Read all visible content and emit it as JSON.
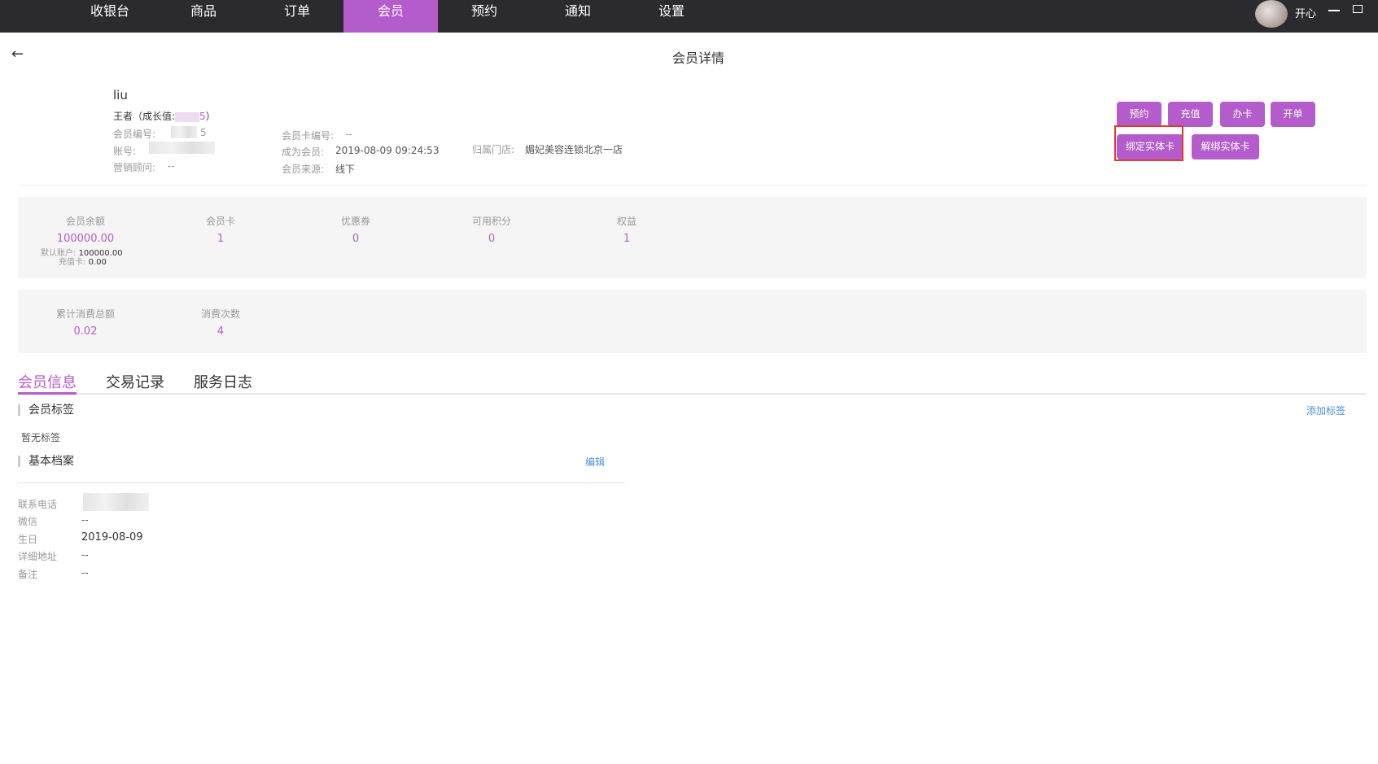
{
  "nav": {
    "items": [
      "收银台",
      "商品",
      "订单",
      "会员",
      "预约",
      "通知",
      "设置"
    ],
    "active": "会员",
    "user": "开心"
  },
  "page": {
    "title": "会员详情"
  },
  "member": {
    "name": "liu",
    "level_prefix": "王者（成长值:",
    "level_value_suffix": "5",
    "level_close": "）",
    "id_label": "会员编号:",
    "id_suffix": "5",
    "account_label": "账号:",
    "advisor_label": "营销顾问:",
    "advisor": "--",
    "card_no_label": "会员卡编号:",
    "card_no": "--",
    "joined_label": "成为会员:",
    "joined": "2019-08-09 09:24:53",
    "source_label": "会员来源:",
    "source": "线下",
    "store_label": "归属门店:",
    "store": "媚妃美容连锁北京一店"
  },
  "actions": [
    "预约",
    "充值",
    "办卡",
    "开单",
    "绑定实体卡",
    "解绑实体卡"
  ],
  "stats": [
    {
      "label": "会员余额",
      "value": "100000.00"
    },
    {
      "label": "会员卡",
      "value": "1"
    },
    {
      "label": "优惠券",
      "value": "0"
    },
    {
      "label": "可用积分",
      "value": "0"
    },
    {
      "label": "权益",
      "value": "1"
    }
  ],
  "balance_detail": {
    "default_label": "默认账户:",
    "default": "100000.00",
    "recharge_label": "充值卡:",
    "recharge": "0.00"
  },
  "stats2": [
    {
      "label": "累计消费总额",
      "value": "0.02"
    },
    {
      "label": "消费次数",
      "value": "4"
    }
  ],
  "tabs": [
    "会员信息",
    "交易记录",
    "服务日志"
  ],
  "tags": {
    "title": "会员标签",
    "add": "添加标签",
    "empty": "暂无标签"
  },
  "profile": {
    "title": "基本档案",
    "edit": "编辑",
    "fields": [
      {
        "label": "联系电话",
        "value": ""
      },
      {
        "label": "微信",
        "value": "--"
      },
      {
        "label": "生日",
        "value": "2019-08-09"
      },
      {
        "label": "详细地址",
        "value": "--"
      },
      {
        "label": "备注",
        "value": "--"
      }
    ]
  },
  "colors": {
    "accent": "#b45ccc",
    "link": "#4a90e2",
    "highlight": "#e53935"
  }
}
